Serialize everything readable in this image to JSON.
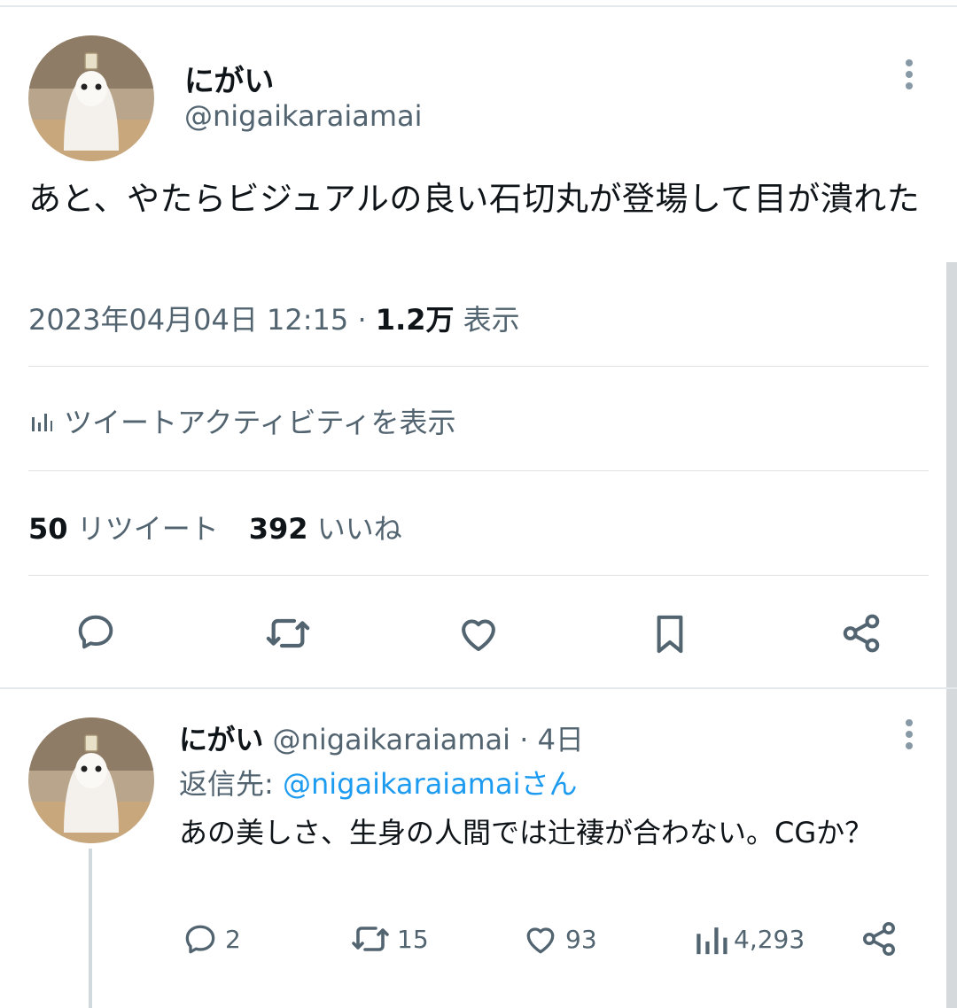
{
  "main_tweet": {
    "display_name": "にがい",
    "handle": "@nigaikaraiamai",
    "text": "あと、やたらビジュアルの良い石切丸が登場して目が潰れた",
    "timestamp": "2023年04月04日 12:15",
    "meta_sep": " · ",
    "views_count": "1.2万",
    "views_label": " 表示",
    "activity_label": "ツイートアクティビティを表示",
    "retweets_count": "50",
    "retweets_label": "リツイート",
    "likes_count": "392",
    "likes_label": "いいね",
    "actions": [
      "reply-icon",
      "retweet-icon",
      "like-icon",
      "bookmark-icon",
      "share-icon"
    ]
  },
  "reply": {
    "display_name": "にがい",
    "handle": "@nigaikaraiamai",
    "time_sep": " · ",
    "age": "4日",
    "reply_to_prefix": "返信先: ",
    "reply_to_handle": "@nigaikaraiamaiさん",
    "text": "あの美しさ、生身の人間では辻褄が合わない。CGか？",
    "reply_count": "2",
    "retweet_count": "15",
    "like_count": "93",
    "view_count": "4,293"
  },
  "colors": {
    "text_primary": "#0f1419",
    "text_secondary": "#536471",
    "link": "#1d9bf0",
    "divider": "#dfe3e6"
  }
}
